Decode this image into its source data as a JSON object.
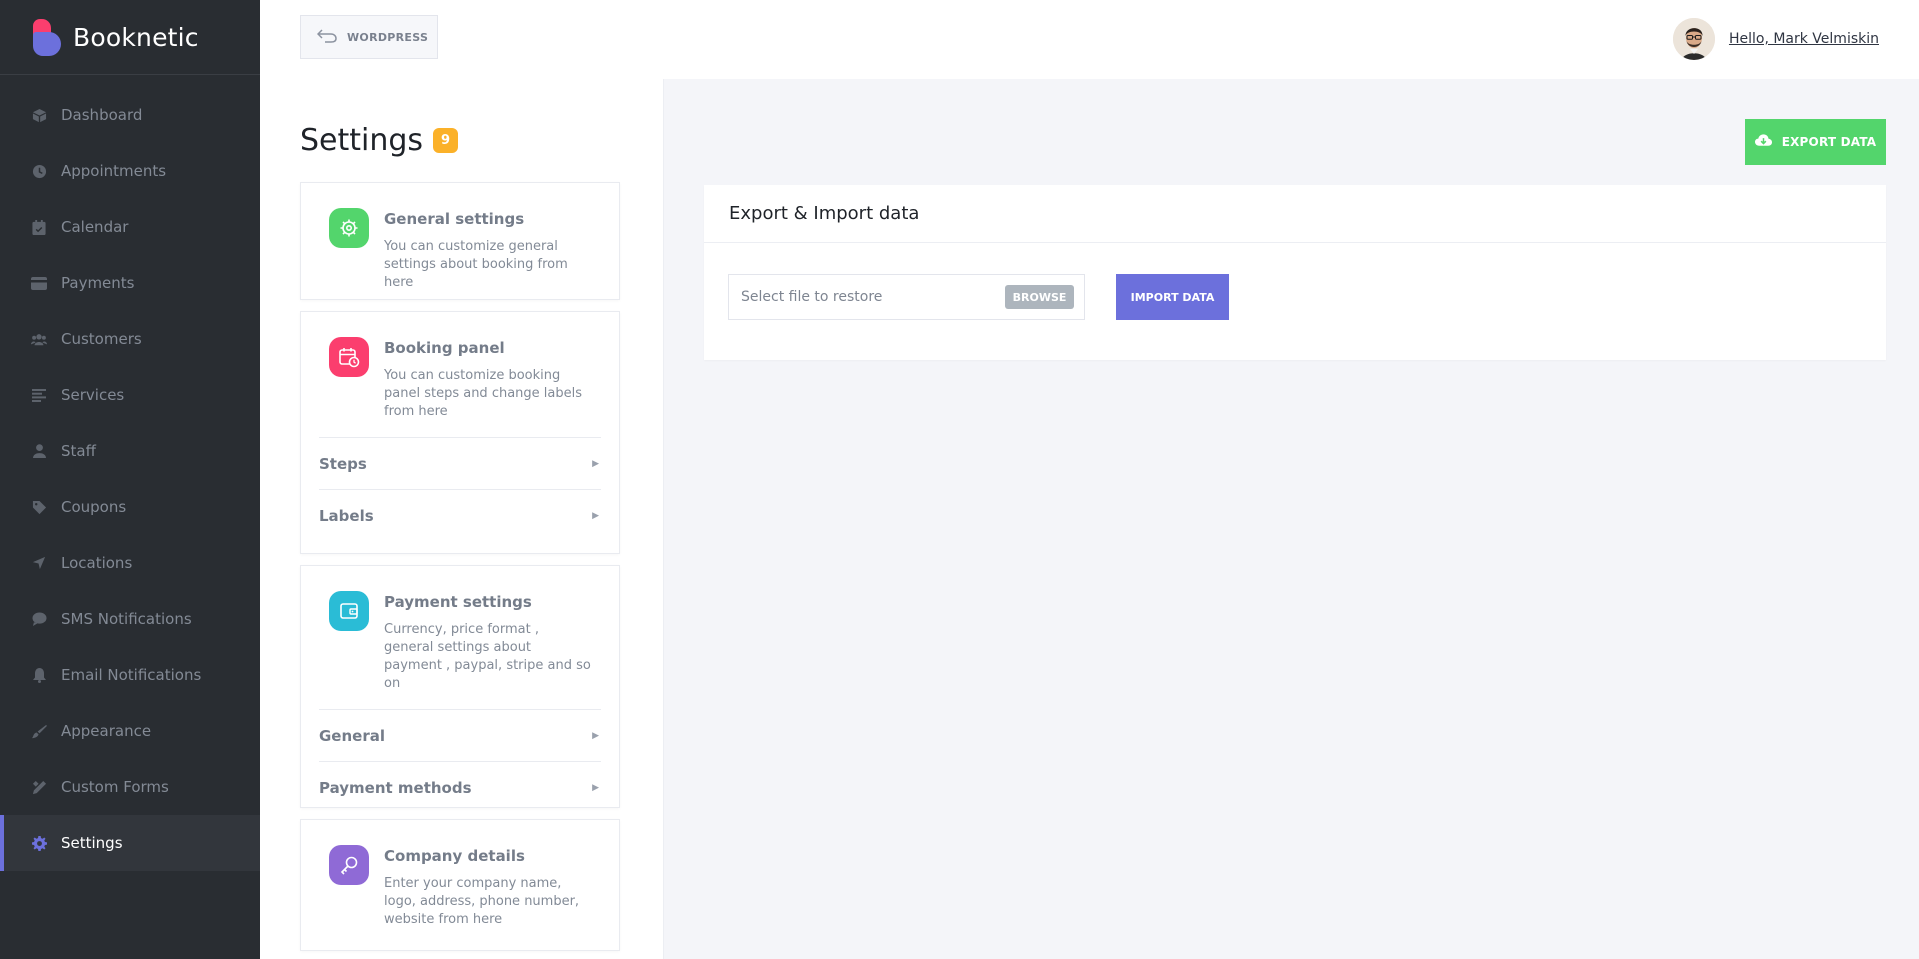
{
  "brand": {
    "name": "Booknetic"
  },
  "sidebar": {
    "items": [
      {
        "label": "Dashboard",
        "icon": "cube-icon"
      },
      {
        "label": "Appointments",
        "icon": "clock-icon"
      },
      {
        "label": "Calendar",
        "icon": "calendar-icon"
      },
      {
        "label": "Payments",
        "icon": "credit-card-icon"
      },
      {
        "label": "Customers",
        "icon": "users-icon"
      },
      {
        "label": "Services",
        "icon": "list-icon"
      },
      {
        "label": "Staff",
        "icon": "user-icon"
      },
      {
        "label": "Coupons",
        "icon": "tag-icon"
      },
      {
        "label": "Locations",
        "icon": "location-arrow-icon"
      },
      {
        "label": "SMS Notifications",
        "icon": "chat-bubble-icon"
      },
      {
        "label": "Email Notifications",
        "icon": "bell-icon"
      },
      {
        "label": "Appearance",
        "icon": "brush-icon"
      },
      {
        "label": "Custom Forms",
        "icon": "pen-ruler-icon"
      },
      {
        "label": "Settings",
        "icon": "gear-icon",
        "active": true
      }
    ]
  },
  "header": {
    "wordpress_label": "WORDPRESS",
    "greeting": "Hello, Mark Velmiskin"
  },
  "settings": {
    "title": "Settings",
    "count": "9",
    "cards": [
      {
        "title": "General settings",
        "desc": "You can customize general settings about booking from here",
        "color": "#53d56c"
      },
      {
        "title": "Booking panel",
        "desc": "You can customize booking panel steps and change labels from here",
        "color": "#fb3e6e",
        "sub": [
          "Steps",
          "Labels"
        ]
      },
      {
        "title": "Payment settings",
        "desc": "Currency, price format , general settings about payment , paypal, stripe and so on",
        "color": "#2abcd6",
        "sub": [
          "General",
          "Payment methods"
        ]
      },
      {
        "title": "Company details",
        "desc": "Enter your company name, logo, address, phone number, website from here",
        "color": "#8f6ad6"
      }
    ]
  },
  "main": {
    "export_label": "EXPORT DATA",
    "panel_title": "Export & Import data",
    "file_placeholder": "Select file to restore",
    "browse_label": "BROWSE",
    "import_label": "IMPORT DATA"
  },
  "colors": {
    "accent": "#6c70dc",
    "success": "#53d56c",
    "badge": "#fbb129",
    "sidebar": "#292d32"
  }
}
